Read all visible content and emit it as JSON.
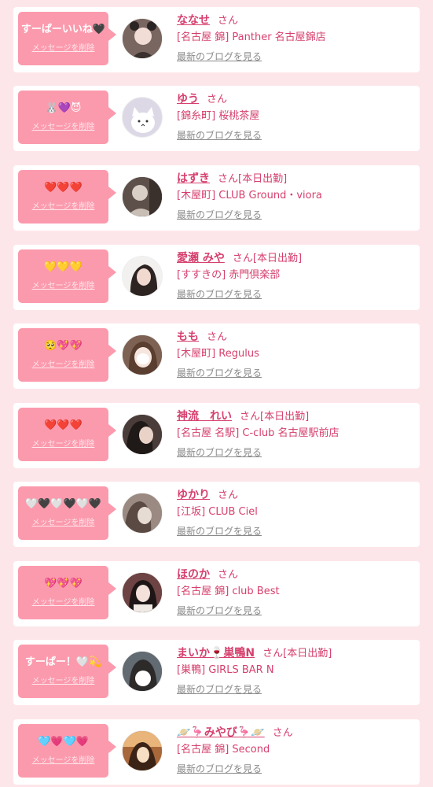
{
  "entries": [
    {
      "message": "すーぱーいいね🖤",
      "delete_label": "メッセージを削除",
      "name": "ななせ",
      "honorific": "さん",
      "working": "",
      "shop": "[名古屋 錦] Panther 名古屋錦店",
      "blog_label": "最新のブログを見る"
    },
    {
      "message": "🐰💜😈",
      "delete_label": "メッセージを削除",
      "name": "ゆう",
      "honorific": "さん",
      "working": "",
      "shop": "[錦糸町] 桜桃茶屋",
      "blog_label": "最新のブログを見る"
    },
    {
      "message": "❤️❤️❤️",
      "delete_label": "メッセージを削除",
      "name": "はずき",
      "honorific": "さん",
      "working": "[本日出勤]",
      "shop": "[木屋町] CLUB Ground・viora",
      "blog_label": "最新のブログを見る"
    },
    {
      "message": "💛💛💛",
      "delete_label": "メッセージを削除",
      "name": "愛瀬 みや",
      "honorific": "さん",
      "working": "[本日出勤]",
      "shop": "[すすきの] 赤門倶楽部",
      "blog_label": "最新のブログを見る"
    },
    {
      "message": "🥺💖💖",
      "delete_label": "メッセージを削除",
      "name": "もも",
      "honorific": "さん",
      "working": "",
      "shop": "[木屋町] Regulus",
      "blog_label": "最新のブログを見る"
    },
    {
      "message": "❤️❤️❤️",
      "delete_label": "メッセージを削除",
      "name": "神流　れい",
      "honorific": "さん",
      "working": "[本日出勤]",
      "shop": "[名古屋 名駅] C-club 名古屋駅前店",
      "blog_label": "最新のブログを見る"
    },
    {
      "message": "🤍🖤🤍🖤🤍🖤",
      "delete_label": "メッセージを削除",
      "name": "ゆかり",
      "honorific": "さん",
      "working": "",
      "shop": "[江坂] CLUB Ciel",
      "blog_label": "最新のブログを見る"
    },
    {
      "message": "💖💖💖",
      "delete_label": "メッセージを削除",
      "name": "ほのか",
      "honorific": "さん",
      "working": "",
      "shop": "[名古屋 錦] club Best",
      "blog_label": "最新のブログを見る"
    },
    {
      "message": "すーぱー！🤍💫",
      "delete_label": "メッセージを削除",
      "name": "まいか🍷巣鴨N",
      "honorific": "さん",
      "working": "[本日出勤]",
      "shop": "[巣鴨] GIRLS BAR N",
      "blog_label": "最新のブログを見る"
    },
    {
      "message": "🩵💗🩵💗",
      "delete_label": "メッセージを削除",
      "name": "🪐🦩みやび🦩🪐",
      "honorific": "さん",
      "working": "",
      "shop": "[名古屋 錦] Second",
      "blog_label": "最新のブログを見る"
    }
  ],
  "avatars": [
    {
      "icon": "avatar-photo",
      "bg": "#6b5a55",
      "fg": "#f2ddd6"
    },
    {
      "icon": "avatar-cat-illustration",
      "bg": "#e9e6ee",
      "fg": "#ffffff"
    },
    {
      "icon": "avatar-photo",
      "bg": "#4b3f3a",
      "fg": "#d8cfc6"
    },
    {
      "icon": "avatar-photo",
      "bg": "#f1efee",
      "fg": "#caa79b"
    },
    {
      "icon": "avatar-photo",
      "bg": "#6e5446",
      "fg": "#f6e6dd"
    },
    {
      "icon": "avatar-photo",
      "bg": "#3d3230",
      "fg": "#e9d3c8"
    },
    {
      "icon": "avatar-photo",
      "bg": "#8b7a72",
      "fg": "#e7dcd4"
    },
    {
      "icon": "avatar-photo",
      "bg": "#5a3a3a",
      "fg": "#f3e1da"
    },
    {
      "icon": "avatar-photo",
      "bg": "#555c63",
      "fg": "#ffffff"
    },
    {
      "icon": "avatar-photo",
      "bg": "#b0743a",
      "fg": "#f7dfc3"
    }
  ],
  "colors": {
    "page_bg": "#fde6ea",
    "bubble_bg": "#fc9aad",
    "name": "#d6406e",
    "link_gray": "#8a8a8a"
  }
}
